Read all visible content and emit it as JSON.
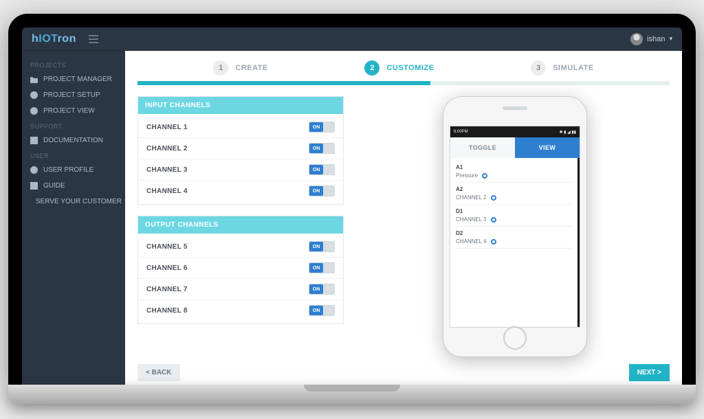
{
  "brand": {
    "p1": "h",
    "p2": "IOT",
    "p3": "ron"
  },
  "user": {
    "name": "ishan"
  },
  "sidebar": {
    "sections": [
      {
        "title": "PROJECTS",
        "items": [
          {
            "label": "PROJECT MANAGER",
            "icon": "folder-icon"
          },
          {
            "label": "PROJECT SETUP",
            "icon": "gear-icon"
          },
          {
            "label": "PROJECT VIEW",
            "icon": "eye-icon"
          }
        ]
      },
      {
        "title": "SUPPORT",
        "items": [
          {
            "label": "DOCUMENTATION",
            "icon": "book-icon"
          }
        ]
      },
      {
        "title": "USER",
        "items": [
          {
            "label": "USER PROFILE",
            "icon": "user-icon"
          },
          {
            "label": "GUIDE",
            "icon": "question-icon"
          },
          {
            "label": "SERVE YOUR CUSTOMER",
            "icon": "folder-icon"
          }
        ]
      }
    ]
  },
  "steps": [
    {
      "num": "1",
      "label": "CREATE"
    },
    {
      "num": "2",
      "label": "CUSTOMIZE"
    },
    {
      "num": "3",
      "label": "SIMULATE"
    }
  ],
  "progress_percent": 55,
  "panels": {
    "input": {
      "title": "INPUT CHANNELS",
      "rows": [
        {
          "label": "CHANNEL 1",
          "on": "ON"
        },
        {
          "label": "CHANNEL 2",
          "on": "ON"
        },
        {
          "label": "CHANNEL 3",
          "on": "ON"
        },
        {
          "label": "CHANNEL 4",
          "on": "ON"
        }
      ]
    },
    "output": {
      "title": "OUTPUT CHANNELS",
      "rows": [
        {
          "label": "CHANNEL 5",
          "on": "ON"
        },
        {
          "label": "CHANNEL 6",
          "on": "ON"
        },
        {
          "label": "CHANNEL 7",
          "on": "ON"
        },
        {
          "label": "CHANNEL 8",
          "on": "ON"
        }
      ]
    }
  },
  "phone": {
    "time": "6:00PM",
    "tabs": {
      "toggle": "TOGGLE",
      "view": "VIEW"
    },
    "items": [
      {
        "id": "A1",
        "label": "Pressure"
      },
      {
        "id": "A2",
        "label": "CHANNEL 2"
      },
      {
        "id": "D1",
        "label": "CHANNEL 3"
      },
      {
        "id": "D2",
        "label": "CHANNEL 4"
      }
    ]
  },
  "buttons": {
    "back": "< BACK",
    "next": "NEXT >"
  }
}
